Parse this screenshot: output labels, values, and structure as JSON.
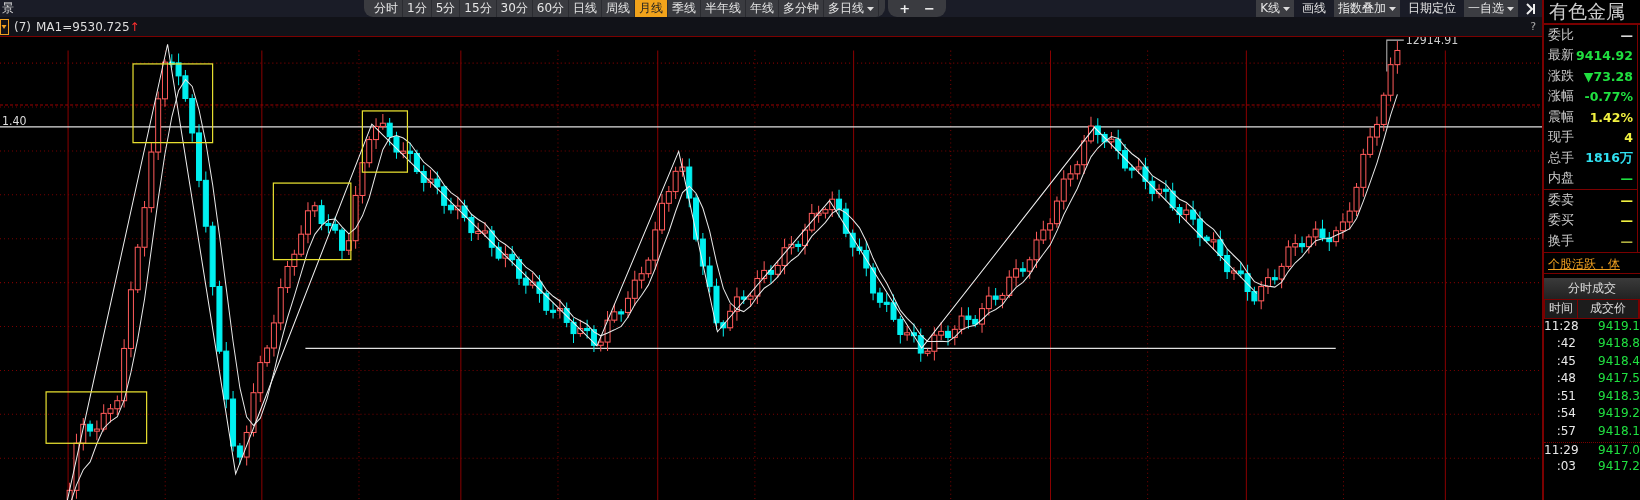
{
  "corner_label": "景",
  "period_tabs": [
    {
      "label": "分时",
      "selected": false
    },
    {
      "label": "1分",
      "selected": false
    },
    {
      "label": "5分",
      "selected": false
    },
    {
      "label": "15分",
      "selected": false
    },
    {
      "label": "30分",
      "selected": false
    },
    {
      "label": "60分",
      "selected": false
    },
    {
      "label": "日线",
      "selected": false
    },
    {
      "label": "周线",
      "selected": false
    },
    {
      "label": "月线",
      "selected": true
    },
    {
      "label": "季线",
      "selected": false
    },
    {
      "label": "半年线",
      "selected": false
    },
    {
      "label": "年线",
      "selected": false
    },
    {
      "label": "多分钟",
      "selected": false
    },
    {
      "label": "多日线",
      "selected": false,
      "dropdown": true
    }
  ],
  "zoom_buttons": [
    "+",
    "−"
  ],
  "tools": [
    {
      "label": "K线",
      "dropdown": true
    },
    {
      "label": "画线",
      "dropdown": false
    },
    {
      "label": "指数叠加",
      "dropdown": true
    },
    {
      "label": "日期定位",
      "dropdown": false
    },
    {
      "label": "一自选",
      "dropdown": true
    }
  ],
  "indicator": {
    "count": "(7)",
    "value": "MA1=9530.725",
    "trend": "↑"
  },
  "help": "?",
  "chart": {
    "kind": "picture",
    "level_label": "1.40",
    "high_label": "12914.91"
  },
  "quote": {
    "title": "有色金属",
    "rows": [
      {
        "label": "委比",
        "value": "—",
        "color": "#d8d8d8"
      },
      {
        "label": "最新",
        "value": "9414.92",
        "color": "#20e040"
      },
      {
        "label": "涨跌",
        "value": "▼73.28",
        "color": "#20e040"
      },
      {
        "label": "涨幅",
        "value": "-0.77%",
        "color": "#20e040"
      },
      {
        "label": "震幅",
        "value": "1.42%",
        "color": "#f0f040"
      },
      {
        "label": "现手",
        "value": "4",
        "color": "#f0f040"
      },
      {
        "label": "总手",
        "value": "1816万",
        "color": "#30e0f0"
      },
      {
        "label": "内盘",
        "value": "—",
        "color": "#20e040"
      }
    ],
    "order_rows": [
      {
        "label": "委卖",
        "value": "—",
        "color": "#f0f040"
      },
      {
        "label": "委买",
        "value": "—",
        "color": "#f0f040"
      },
      {
        "label": "换手",
        "value": "—",
        "color": "#b0b040"
      }
    ]
  },
  "ticker": "个股活跃，体",
  "trades": {
    "title": "分时成交",
    "columns": [
      "时间",
      "成交价"
    ],
    "rows": [
      {
        "time": "11:28",
        "price": "9419.1"
      },
      {
        "time": ":42",
        "price": "9418.8"
      },
      {
        "time": ":45",
        "price": "9418.4"
      },
      {
        "time": ":48",
        "price": "9417.5"
      },
      {
        "time": ":51",
        "price": "9418.3"
      },
      {
        "time": ":54",
        "price": "9419.2"
      },
      {
        "time": ":57",
        "price": "9418.1"
      },
      {
        "time": "11:29",
        "price": "9417.0"
      },
      {
        "time": ":03",
        "price": "9417.2"
      }
    ]
  }
}
